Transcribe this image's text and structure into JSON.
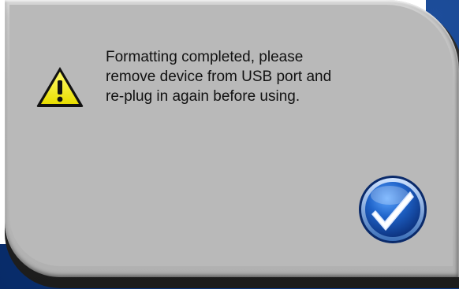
{
  "dialog": {
    "message_lines": [
      "Formatting completed, please",
      "remove device from USB port and",
      "re-plug in again before using."
    ]
  },
  "icons": {
    "warning": "warning-triangle-icon",
    "confirm": "checkmark-icon"
  },
  "colors": {
    "dialog_gray": "#b9b9b9",
    "frame_blue": "#0d3a86",
    "warning_yellow": "#f2ea00",
    "button_blue": "#1a5fc0"
  }
}
